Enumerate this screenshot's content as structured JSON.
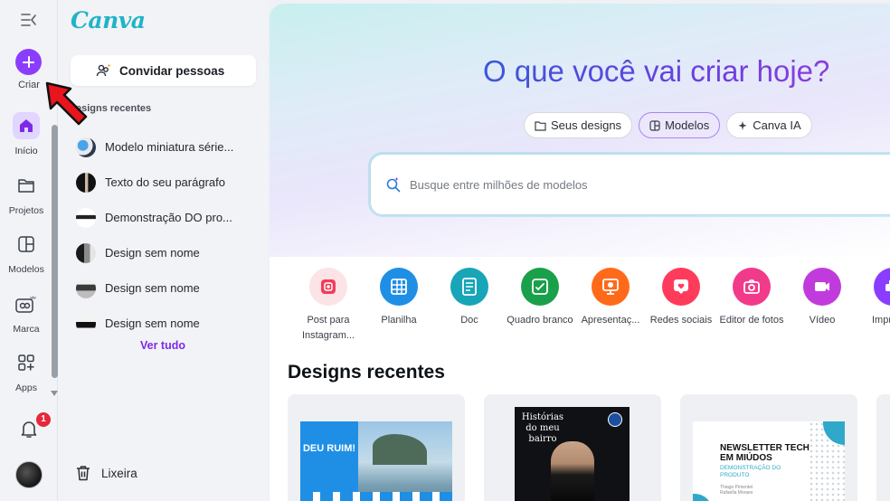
{
  "colors": {
    "brand_purple": "#8b3dff",
    "teal_logo": "#21b3c8",
    "notification_red": "#e5283b"
  },
  "rail": {
    "create_label": "Criar",
    "items": [
      {
        "label": "Início",
        "icon": "home-icon"
      },
      {
        "label": "Projetos",
        "icon": "folder-icon"
      },
      {
        "label": "Modelos",
        "icon": "templates-icon"
      },
      {
        "label": "Marca",
        "icon": "brand-icon"
      },
      {
        "label": "Apps",
        "icon": "apps-icon"
      }
    ],
    "notifications_count": "1"
  },
  "panel": {
    "logo": "Canva",
    "invite_label": "Convidar pessoas",
    "recent_title": "esigns recentes",
    "recent_items": [
      {
        "title": "Modelo miniatura série..."
      },
      {
        "title": "Texto do seu parágrafo"
      },
      {
        "title": "Demonstração DO pro..."
      },
      {
        "title": "Design sem nome"
      },
      {
        "title": "Design sem nome"
      },
      {
        "title": "Design sem nome"
      }
    ],
    "see_all": "Ver tudo",
    "trash_label": "Lixeira"
  },
  "main": {
    "hero_title": "O que você vai criar hoje?",
    "tabs": [
      {
        "label": "Seus designs",
        "icon": "folder-icon"
      },
      {
        "label": "Modelos",
        "icon": "templates-icon"
      },
      {
        "label": "Canva IA",
        "icon": "sparkle-icon"
      }
    ],
    "active_tab": "Modelos",
    "search_placeholder": "Busque entre milhões de modelos",
    "categories": [
      {
        "label": "Post para Instagram...",
        "color": "#fbe3e6"
      },
      {
        "label": "Planilha",
        "color": "#1f8fe6"
      },
      {
        "label": "Doc",
        "color": "#18a5b8"
      },
      {
        "label": "Quadro branco",
        "color": "#1aa04a"
      },
      {
        "label": "Apresentaç...",
        "color": "#ff6a1a"
      },
      {
        "label": "Redes sociais",
        "color": "#ff3b5c"
      },
      {
        "label": "Editor de fotos",
        "color": "#f23a8a"
      },
      {
        "label": "Vídeo",
        "color": "#c13bdc"
      },
      {
        "label": "Impres",
        "color": "#8a3dff"
      }
    ],
    "recent_heading": "Designs recentes",
    "cards": [
      {
        "title": "DEU RUIM!"
      },
      {
        "title": "Histórias do meu bairro"
      },
      {
        "title": "NEWSLETTER TECH EM MIÚDOS",
        "subtitle": "DEMONSTRAÇÃO DO PRODUTO",
        "small": "Thiago Pimentel\nRafaella Moraes"
      }
    ]
  }
}
